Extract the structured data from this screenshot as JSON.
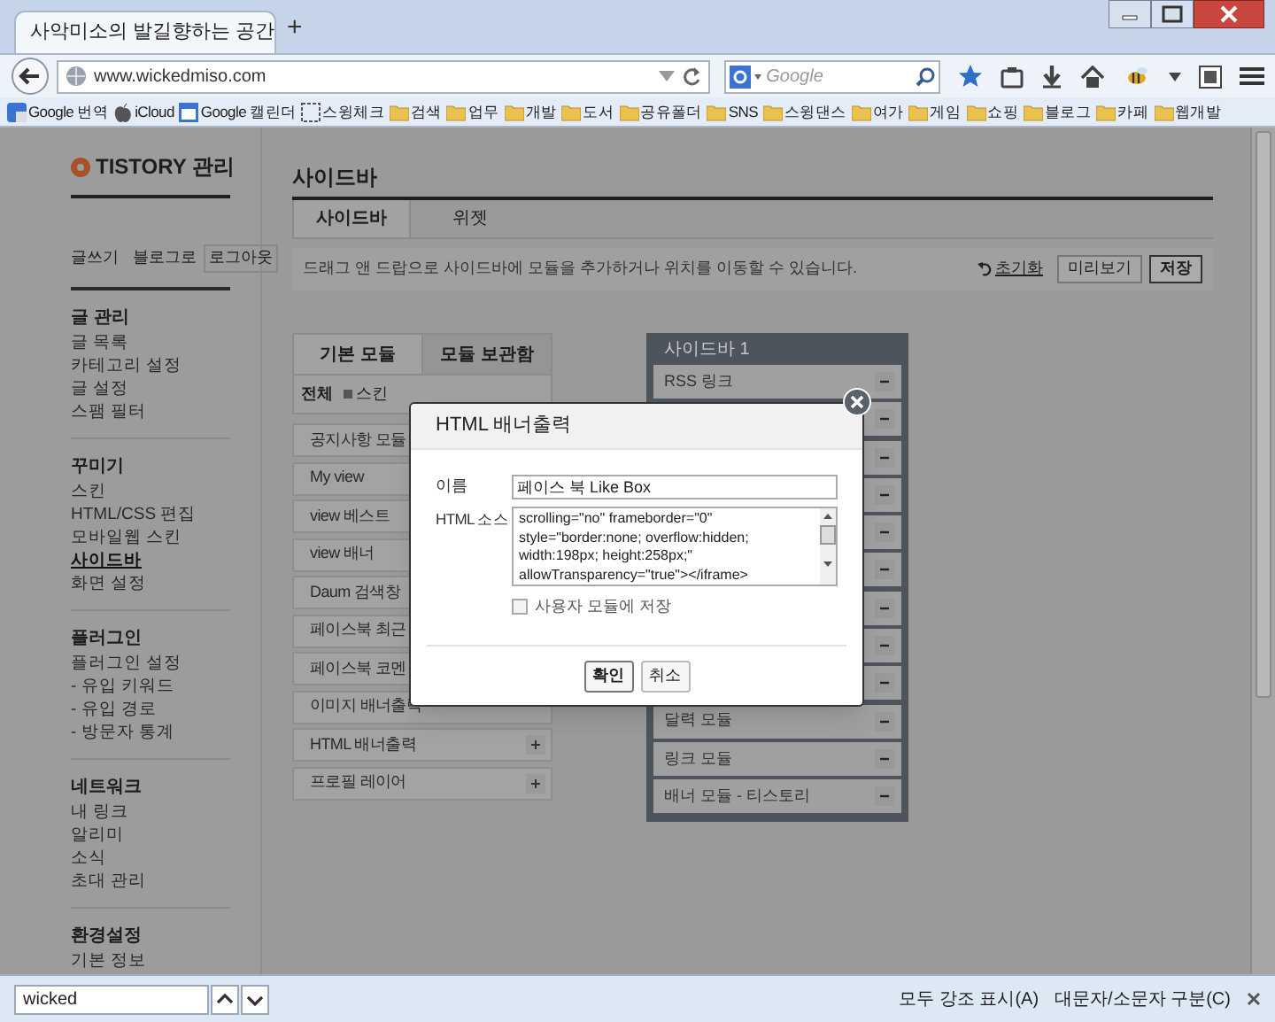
{
  "browser": {
    "tab": {
      "title": "사악미소의 발길향하는 공간"
    },
    "new_tab": "+",
    "url": "www.wickedmiso.com",
    "search": {
      "placeholder": "Google"
    },
    "bookmarks": [
      {
        "label": "Google 번역",
        "kind": "translate"
      },
      {
        "label": "iCloud",
        "kind": "apple"
      },
      {
        "label": "Google 캘린더",
        "kind": "calendar"
      },
      {
        "label": "스윙체크",
        "kind": "page"
      },
      {
        "label": "검색",
        "kind": "folder"
      },
      {
        "label": "업무",
        "kind": "folder"
      },
      {
        "label": "개발",
        "kind": "folder"
      },
      {
        "label": "도서",
        "kind": "folder"
      },
      {
        "label": "공유폴더",
        "kind": "folder"
      },
      {
        "label": "SNS",
        "kind": "folder"
      },
      {
        "label": "스윙댄스",
        "kind": "folder"
      },
      {
        "label": "여가",
        "kind": "folder"
      },
      {
        "label": "게임",
        "kind": "folder"
      },
      {
        "label": "쇼핑",
        "kind": "folder"
      },
      {
        "label": "블로그",
        "kind": "folder"
      },
      {
        "label": "카페",
        "kind": "folder"
      },
      {
        "label": "웹개발",
        "kind": "folder"
      }
    ]
  },
  "admin_sidebar": {
    "logo": "TISTORY 관리",
    "links": [
      "글쓰기",
      "블로그로",
      "로그아웃"
    ],
    "sections": [
      {
        "title": "글 관리",
        "items": [
          {
            "label": "글 목록",
            "selected": false
          },
          {
            "label": "카테고리 설정",
            "selected": false
          },
          {
            "label": "글 설정",
            "selected": false
          },
          {
            "label": "스팸 필터",
            "selected": false
          }
        ]
      },
      {
        "title": "꾸미기",
        "items": [
          {
            "label": "스킨",
            "selected": false
          },
          {
            "label": "HTML/CSS 편집",
            "selected": false
          },
          {
            "label": "모바일웹 스킨",
            "selected": false
          },
          {
            "label": "사이드바",
            "selected": true
          },
          {
            "label": "화면 설정",
            "selected": false
          }
        ]
      },
      {
        "title": "플러그인",
        "items": [
          {
            "label": "플러그인 설정",
            "selected": false
          },
          {
            "label": "- 유입 키워드",
            "selected": false
          },
          {
            "label": "- 유입 경로",
            "selected": false
          },
          {
            "label": "- 방문자 통계",
            "selected": false
          }
        ]
      },
      {
        "title": "네트워크",
        "items": [
          {
            "label": "내 링크",
            "selected": false
          },
          {
            "label": "알리미",
            "selected": false
          },
          {
            "label": "소식",
            "selected": false
          },
          {
            "label": "초대 관리",
            "selected": false
          }
        ]
      },
      {
        "title": "환경설정",
        "items": [
          {
            "label": "기본 정보",
            "selected": false
          }
        ]
      }
    ]
  },
  "main": {
    "title": "사이드바",
    "tabs": [
      {
        "label": "사이드바",
        "selected": true
      },
      {
        "label": "위젯",
        "selected": false
      }
    ],
    "notice": "드래그 앤 드랍으로 사이드바에 모듈을 추가하거나 위치를 이동할 수 있습니다.",
    "reset": "초기화",
    "buttons": [
      "미리보기",
      "저장"
    ]
  },
  "modules": {
    "tabs": [
      {
        "label": "기본 모듈",
        "selected": true
      },
      {
        "label": "모듈 보관함",
        "selected": false
      }
    ],
    "filters": [
      {
        "label": "전체",
        "kind": "all"
      },
      {
        "label": "스킨",
        "kind": "skin"
      }
    ],
    "items": [
      {
        "label": "공지사항 모듈",
        "kind": "covered"
      },
      {
        "label": "My view",
        "kind": "covered"
      },
      {
        "label": "view 베스트",
        "kind": "covered"
      },
      {
        "label": "view 배너",
        "kind": "covered"
      },
      {
        "label": "Daum 검색창",
        "kind": "covered"
      },
      {
        "label": "페이스북 최근",
        "kind": "covered"
      },
      {
        "label": "페이스북 코멘",
        "kind": "covered"
      },
      {
        "label": "이미지 배너출력",
        "kind": "covered"
      },
      {
        "label": "HTML 배너출력",
        "kind": "addable"
      },
      {
        "label": "프로필 레이어",
        "kind": "addable"
      }
    ]
  },
  "sidebar_1": {
    "title": "사이드바 1",
    "items": [
      {
        "kind": "module",
        "label": "RSS 링크"
      },
      {
        "kind": "covered"
      },
      {
        "kind": "covered"
      },
      {
        "kind": "covered"
      },
      {
        "kind": "covered"
      },
      {
        "kind": "covered"
      },
      {
        "kind": "covered"
      },
      {
        "kind": "covered"
      },
      {
        "kind": "covered"
      },
      {
        "kind": "module",
        "label": "달력 모듈"
      },
      {
        "kind": "module",
        "label": "링크 모듈"
      },
      {
        "kind": "module",
        "label": "배너 모듈 - 티스토리"
      }
    ]
  },
  "modal": {
    "title": "HTML 배너출력",
    "name_field": {
      "label": "이름",
      "value": "페이스 북 Like Box"
    },
    "source_field": {
      "label": "HTML 소스",
      "lines": [
        "scrolling=\"no\" frameborder=\"0\"",
        "style=\"border:none; overflow:hidden;",
        "width:198px; height:258px;\"",
        "allowTransparency=\"true\"></iframe>"
      ]
    },
    "checkbox": {
      "label": "사용자 모듈에 저장",
      "checked": false
    },
    "buttons": [
      {
        "label": "확인",
        "primary": true
      },
      {
        "label": "취소",
        "primary": false
      }
    ]
  },
  "find_bar": {
    "query": "wicked",
    "options": [
      "모두 강조 표시(A)",
      "대문자/소문자 구분(C)"
    ]
  }
}
